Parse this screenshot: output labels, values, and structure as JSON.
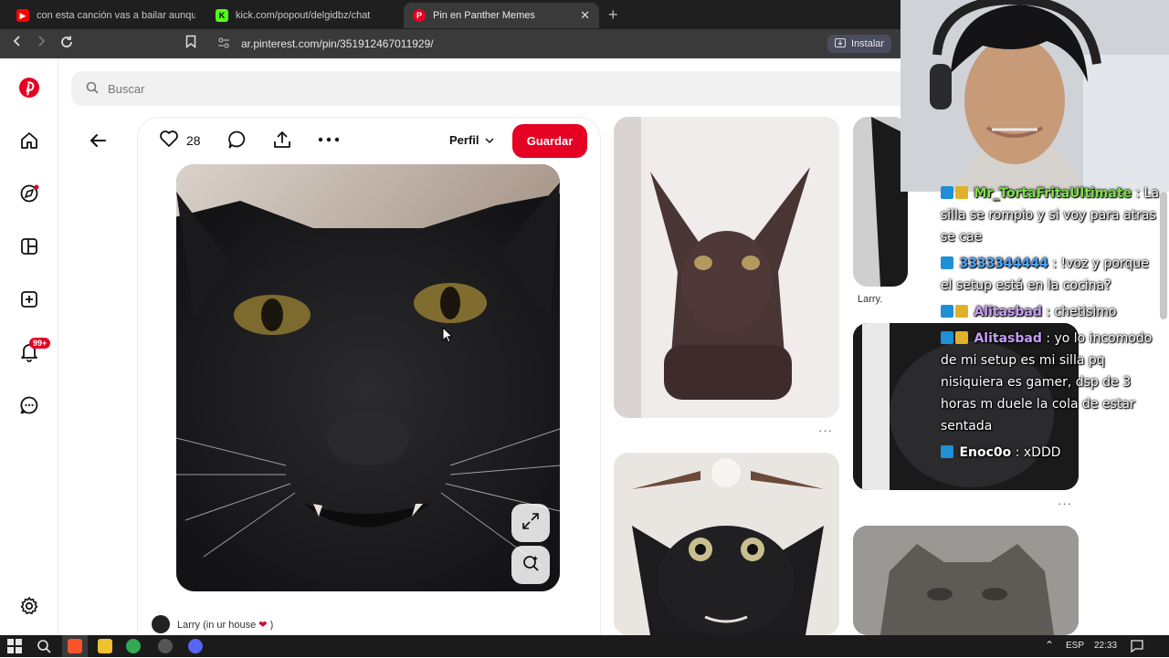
{
  "browser": {
    "tabs": [
      {
        "title": "con esta canción vas a bailar aunque",
        "favicon": "youtube-favicon",
        "color": "#ff0000"
      },
      {
        "title": "kick.com/popout/delgidbz/chat",
        "favicon": "kick-favicon",
        "color": "#53fc18"
      },
      {
        "title": "Pin en Panther Memes",
        "favicon": "pinterest-favicon",
        "color": "#e60023",
        "active": true
      }
    ],
    "url": "ar.pinterest.com/pin/351912467011929/",
    "install_label": "Instalar"
  },
  "pinterest": {
    "search_placeholder": "Buscar",
    "notifications_badge": "99+",
    "pin": {
      "likes": "28",
      "profile_label": "Perfil",
      "save_label": "Guardar",
      "author_caption": "Larry (in ur house",
      "author_caption_end": ")"
    },
    "grid": {
      "caption_1": "Larry.",
      "dots": "···"
    }
  },
  "chat": [
    {
      "user": "Mr_TortaFritaUltimate",
      "user_color": "#7ee04a",
      "text": ": La silla se rompio y si voy para atras se cae"
    },
    {
      "user": "3333344444",
      "user_color": "#4aa3ff",
      "text": ": !voz y porque el setup está en la cocina?"
    },
    {
      "user": "Alitasbad",
      "user_color": "#c59cf5",
      "text": ": chetisimo"
    },
    {
      "user": "Alitasbad",
      "user_color": "#c59cf5",
      "text": ": yo lo incomodo de mi setup es mi silla pq nisiquiera es gamer, dsp de 3 horas m duele la cola de estar sentada"
    },
    {
      "user": "Enoc0o",
      "user_color": "#ffffff",
      "text": ": xDDD"
    }
  ],
  "taskbar": {
    "language": "ESP",
    "time": "22:33"
  },
  "colors": {
    "pinterest_red": "#e60023",
    "chrome_dark": "#1f1f1f"
  }
}
